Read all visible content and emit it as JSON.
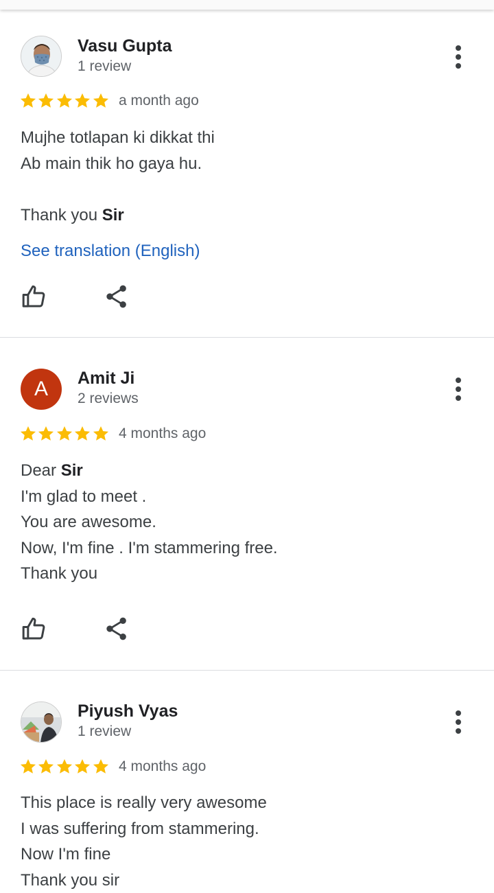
{
  "reviews": [
    {
      "name": "Vasu Gupta",
      "count": "1 review",
      "rating": 5,
      "when": "a month ago",
      "lines": [
        "Mujhe totlapan ki dikkat thi",
        "Ab main thik ho gaya hu.",
        "",
        "Thank you "
      ],
      "bold_tail": "Sir",
      "translate": "See translation (English)"
    },
    {
      "name": "Amit Ji",
      "avatar_letter": "A",
      "count": "2 reviews",
      "rating": 5,
      "when": "4 months ago",
      "first_prefix": "Dear ",
      "first_bold": "Sir",
      "lines": [
        "I'm glad to meet .",
        "You are awesome.",
        "Now, I'm fine . I'm stammering free.",
        "Thank you"
      ]
    },
    {
      "name": "Piyush Vyas",
      "count": "1 review",
      "rating": 5,
      "when": "4 months ago",
      "lines": [
        "This place is really very awesome",
        "I was suffering from stammering.",
        "Now I'm fine",
        "Thank you sir"
      ]
    }
  ],
  "colors": {
    "star": "#fbbc04",
    "link": "#1a73e8",
    "avatar_a": "#c1350f"
  },
  "icons": {
    "like": "thumbs-up-icon",
    "share": "share-icon",
    "more": "more-vert-icon"
  }
}
